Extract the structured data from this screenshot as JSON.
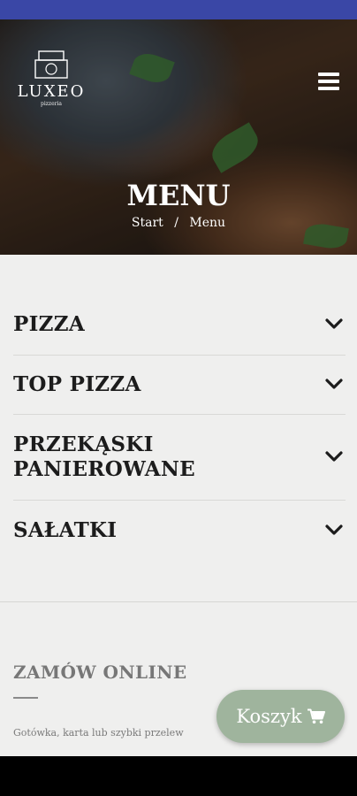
{
  "header": {
    "logo_name": "LUXEO",
    "logo_sub": "pizzeria",
    "menu_icon": "hamburger-icon"
  },
  "hero": {
    "title": "MENU",
    "breadcrumb": {
      "home": "Start",
      "separator": "/",
      "current": "Menu"
    }
  },
  "menu": {
    "items": [
      {
        "label": "PIZZA",
        "icon": "chevron-down-icon"
      },
      {
        "label": "TOP PIZZA",
        "icon": "chevron-down-icon"
      },
      {
        "label_line1": "PRZEKĄSKI",
        "label_line2": "PANIEROWANE",
        "icon": "chevron-down-icon"
      },
      {
        "label": "SAŁATKI",
        "icon": "chevron-down-icon"
      }
    ]
  },
  "online": {
    "title": "ZAMÓW ONLINE",
    "description": "Gotówka, karta lub szybki przelew"
  },
  "cart": {
    "label": "Koszyk",
    "icon": "cart-icon"
  },
  "colors": {
    "status_bar": "#3a47a6",
    "cart_button": "#9fb49d",
    "page_background": "#efefee"
  }
}
